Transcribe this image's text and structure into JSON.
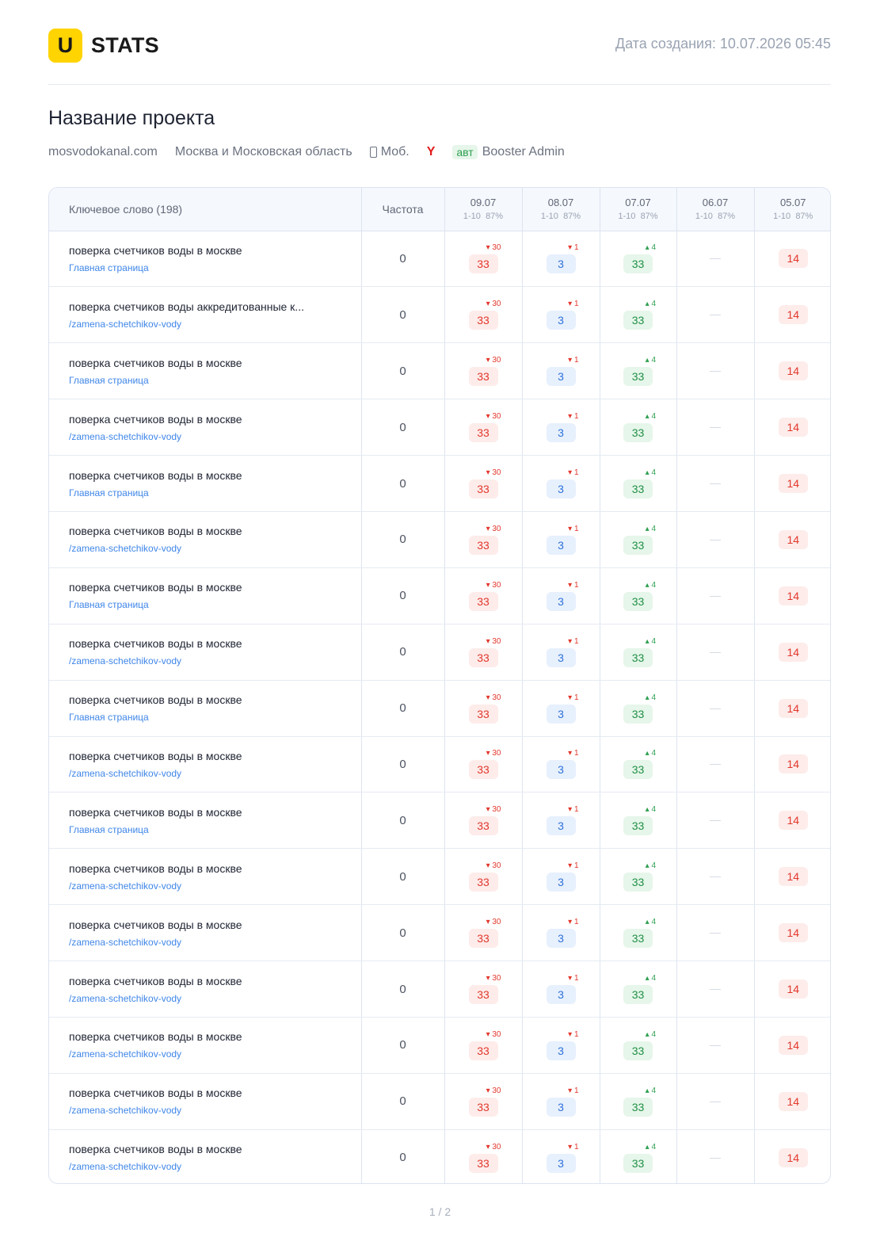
{
  "header": {
    "logo_letter": "U",
    "logo_text": "STATS",
    "created": "Дата создания: 10.07.2026 05:45"
  },
  "project": {
    "title": "Название проекта",
    "domain": "mosvodokanal.com",
    "region": "Москва и Московская область",
    "device": "Моб.",
    "search_engine": "Y",
    "auto_badge": "авт",
    "author": "Booster Admin"
  },
  "table": {
    "keyword_header": "Ключевое слово (198)",
    "freq_header": "Частота",
    "dates": [
      {
        "date": "09.07",
        "range": "1-10",
        "pct": "87%"
      },
      {
        "date": "08.07",
        "range": "1-10",
        "pct": "87%"
      },
      {
        "date": "07.07",
        "range": "1-10",
        "pct": "87%"
      },
      {
        "date": "06.07",
        "range": "1-10",
        "pct": "87%"
      },
      {
        "date": "05.07",
        "range": "1-10",
        "pct": "87%"
      }
    ],
    "rows": [
      {
        "keyword": "поверка счетчиков воды в москве",
        "url": "Главная страница",
        "freq": "0",
        "c1": "33",
        "d1": "30",
        "c2": "3",
        "d2": "1",
        "c3": "33",
        "d3": "4",
        "c4": "—",
        "c5": "14"
      },
      {
        "keyword": "поверка счетчиков воды аккредитованные к...",
        "url": "/zamena-schetchikov-vody",
        "freq": "0",
        "c1": "33",
        "d1": "30",
        "c2": "3",
        "d2": "1",
        "c3": "33",
        "d3": "4",
        "c4": "—",
        "c5": "14"
      },
      {
        "keyword": "поверка счетчиков воды в москве",
        "url": "Главная страница",
        "freq": "0",
        "c1": "33",
        "d1": "30",
        "c2": "3",
        "d2": "1",
        "c3": "33",
        "d3": "4",
        "c4": "—",
        "c5": "14"
      },
      {
        "keyword": "поверка счетчиков воды в москве",
        "url": "/zamena-schetchikov-vody",
        "freq": "0",
        "c1": "33",
        "d1": "30",
        "c2": "3",
        "d2": "1",
        "c3": "33",
        "d3": "4",
        "c4": "—",
        "c5": "14"
      },
      {
        "keyword": "поверка счетчиков воды в москве",
        "url": "Главная страница",
        "freq": "0",
        "c1": "33",
        "d1": "30",
        "c2": "3",
        "d2": "1",
        "c3": "33",
        "d3": "4",
        "c4": "—",
        "c5": "14"
      },
      {
        "keyword": "поверка счетчиков воды в москве",
        "url": "/zamena-schetchikov-vody",
        "freq": "0",
        "c1": "33",
        "d1": "30",
        "c2": "3",
        "d2": "1",
        "c3": "33",
        "d3": "4",
        "c4": "—",
        "c5": "14"
      },
      {
        "keyword": "поверка счетчиков воды в москве",
        "url": "Главная страница",
        "freq": "0",
        "c1": "33",
        "d1": "30",
        "c2": "3",
        "d2": "1",
        "c3": "33",
        "d3": "4",
        "c4": "—",
        "c5": "14"
      },
      {
        "keyword": "поверка счетчиков воды в москве",
        "url": "/zamena-schetchikov-vody",
        "freq": "0",
        "c1": "33",
        "d1": "30",
        "c2": "3",
        "d2": "1",
        "c3": "33",
        "d3": "4",
        "c4": "—",
        "c5": "14"
      },
      {
        "keyword": "поверка счетчиков воды в москве",
        "url": "Главная страница",
        "freq": "0",
        "c1": "33",
        "d1": "30",
        "c2": "3",
        "d2": "1",
        "c3": "33",
        "d3": "4",
        "c4": "—",
        "c5": "14"
      },
      {
        "keyword": "поверка счетчиков воды в москве",
        "url": "/zamena-schetchikov-vody",
        "freq": "0",
        "c1": "33",
        "d1": "30",
        "c2": "3",
        "d2": "1",
        "c3": "33",
        "d3": "4",
        "c4": "—",
        "c5": "14"
      },
      {
        "keyword": "поверка счетчиков воды в москве",
        "url": "Главная страница",
        "freq": "0",
        "c1": "33",
        "d1": "30",
        "c2": "3",
        "d2": "1",
        "c3": "33",
        "d3": "4",
        "c4": "—",
        "c5": "14"
      },
      {
        "keyword": "поверка счетчиков воды в москве",
        "url": "/zamena-schetchikov-vody",
        "freq": "0",
        "c1": "33",
        "d1": "30",
        "c2": "3",
        "d2": "1",
        "c3": "33",
        "d3": "4",
        "c4": "—",
        "c5": "14"
      },
      {
        "keyword": "поверка счетчиков воды в москве",
        "url": "/zamena-schetchikov-vody",
        "freq": "0",
        "c1": "33",
        "d1": "30",
        "c2": "3",
        "d2": "1",
        "c3": "33",
        "d3": "4",
        "c4": "—",
        "c5": "14"
      },
      {
        "keyword": "поверка счетчиков воды в москве",
        "url": "/zamena-schetchikov-vody",
        "freq": "0",
        "c1": "33",
        "d1": "30",
        "c2": "3",
        "d2": "1",
        "c3": "33",
        "d3": "4",
        "c4": "—",
        "c5": "14"
      },
      {
        "keyword": "поверка счетчиков воды в москве",
        "url": "/zamena-schetchikov-vody",
        "freq": "0",
        "c1": "33",
        "d1": "30",
        "c2": "3",
        "d2": "1",
        "c3": "33",
        "d3": "4",
        "c4": "—",
        "c5": "14"
      },
      {
        "keyword": "поверка счетчиков воды в москве",
        "url": "/zamena-schetchikov-vody",
        "freq": "0",
        "c1": "33",
        "d1": "30",
        "c2": "3",
        "d2": "1",
        "c3": "33",
        "d3": "4",
        "c4": "—",
        "c5": "14"
      },
      {
        "keyword": "поверка счетчиков воды в москве",
        "url": "/zamena-schetchikov-vody",
        "freq": "0",
        "c1": "33",
        "d1": "30",
        "c2": "3",
        "d2": "1",
        "c3": "33",
        "d3": "4",
        "c4": "—",
        "c5": "14"
      }
    ]
  },
  "footer": {
    "page": "1 / 2"
  }
}
